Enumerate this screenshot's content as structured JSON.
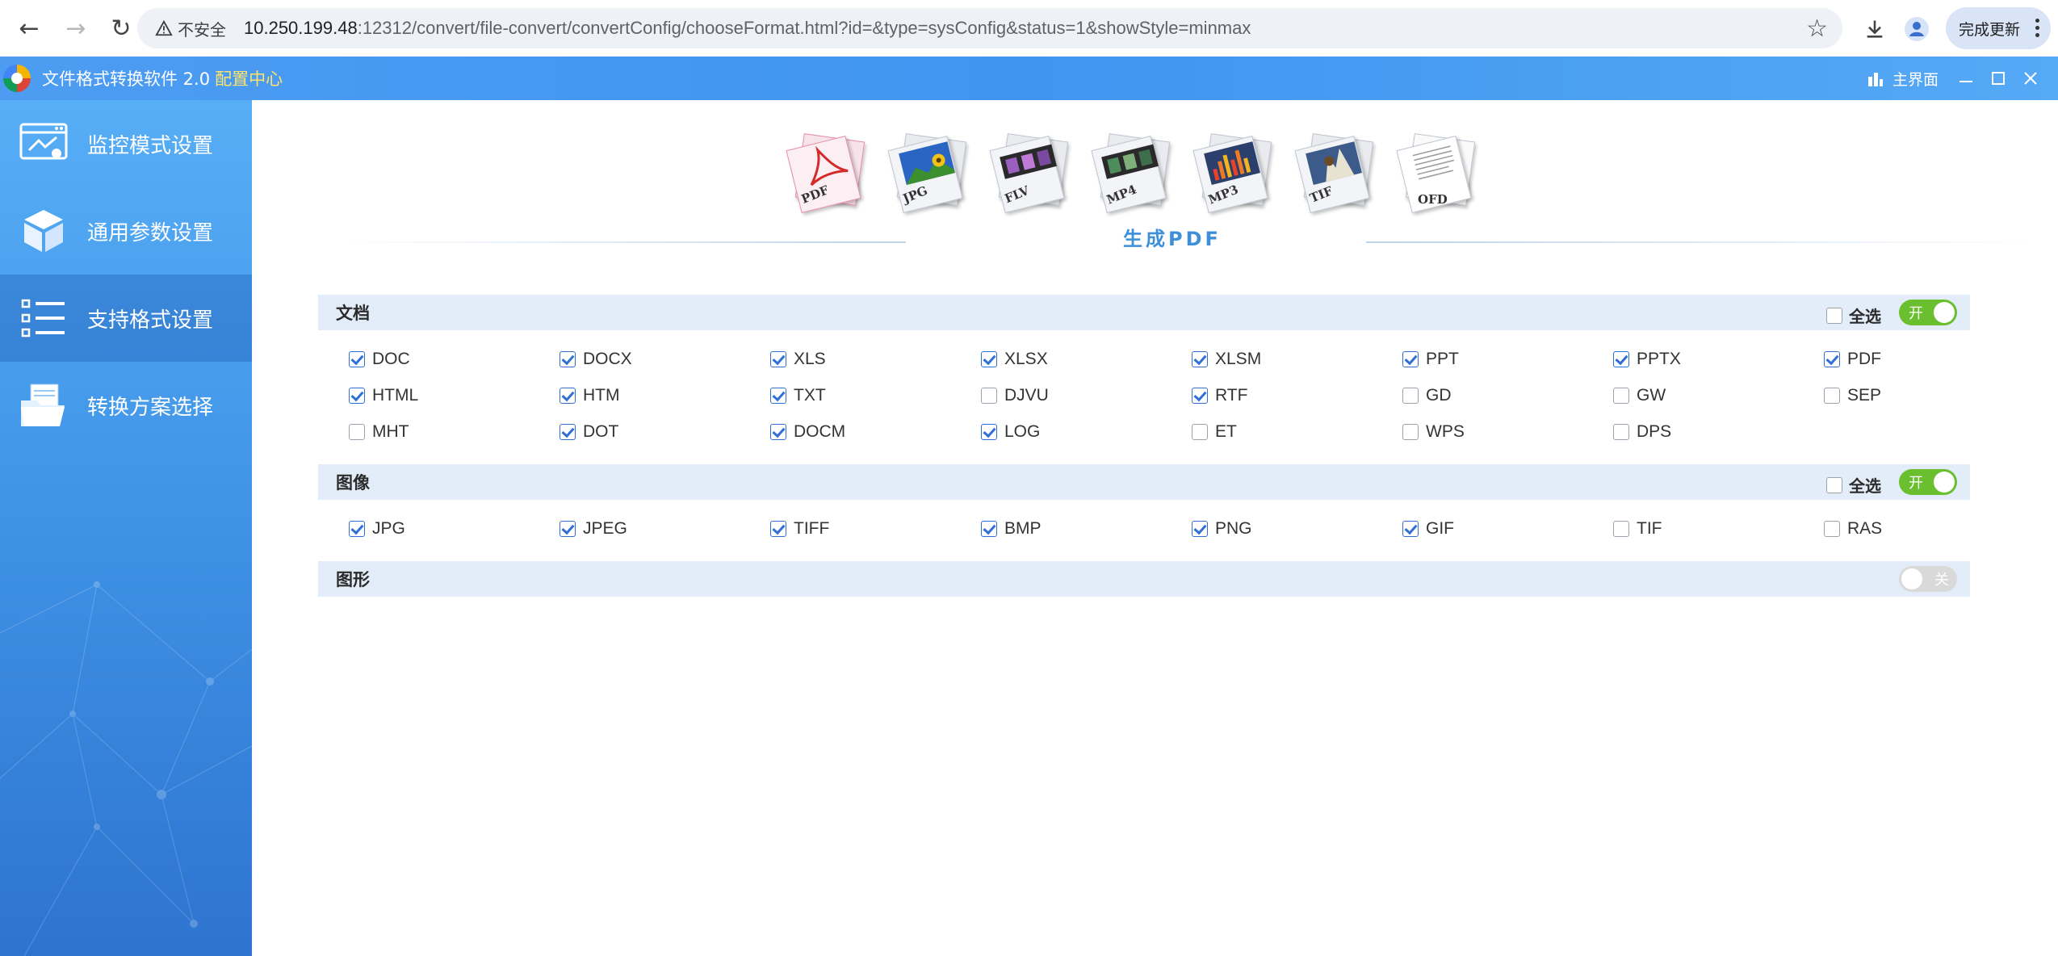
{
  "browser": {
    "security_label": "不安全",
    "url_host": "10.250.199.48",
    "url_path": ":12312/convert/file-convert/convertConfig/chooseFormat.html?id=&type=sysConfig&status=1&showStyle=minmax",
    "update_label": "完成更新"
  },
  "app": {
    "title": "文件格式转换软件 2.0",
    "subtitle": "配置中心",
    "main_label": "主界面"
  },
  "sidebar": {
    "items": [
      {
        "label": "监控模式设置",
        "active": false
      },
      {
        "label": "通用参数设置",
        "active": false
      },
      {
        "label": "支持格式设置",
        "active": true
      },
      {
        "label": "转换方案选择",
        "active": false
      }
    ]
  },
  "format_icons": [
    {
      "label": "PDF",
      "icon": "pdf-icon",
      "selected": true
    },
    {
      "label": "JPG",
      "icon": "jpg-icon",
      "selected": false
    },
    {
      "label": "FLV",
      "icon": "flv-icon",
      "selected": false
    },
    {
      "label": "MP4",
      "icon": "mp4-icon",
      "selected": false
    },
    {
      "label": "MP3",
      "icon": "mp3-icon",
      "selected": false
    },
    {
      "label": "TIF",
      "icon": "tif-icon",
      "selected": false
    },
    {
      "label": "OFD",
      "icon": "ofd-icon",
      "selected": false
    }
  ],
  "generate_title": "生成PDF",
  "sections": [
    {
      "title": "文档",
      "select_all_label": "全选",
      "select_all_checked": false,
      "toggle_label": "开",
      "toggle_on": true,
      "formats": [
        {
          "label": "DOC",
          "checked": true
        },
        {
          "label": "DOCX",
          "checked": true
        },
        {
          "label": "XLS",
          "checked": true
        },
        {
          "label": "XLSX",
          "checked": true
        },
        {
          "label": "XLSM",
          "checked": true
        },
        {
          "label": "PPT",
          "checked": true
        },
        {
          "label": "PPTX",
          "checked": true
        },
        {
          "label": "PDF",
          "checked": true
        },
        {
          "label": "HTML",
          "checked": true
        },
        {
          "label": "HTM",
          "checked": true
        },
        {
          "label": "TXT",
          "checked": true
        },
        {
          "label": "DJVU",
          "checked": false
        },
        {
          "label": "RTF",
          "checked": true
        },
        {
          "label": "GD",
          "checked": false
        },
        {
          "label": "GW",
          "checked": false
        },
        {
          "label": "SEP",
          "checked": false
        },
        {
          "label": "MHT",
          "checked": false
        },
        {
          "label": "DOT",
          "checked": true
        },
        {
          "label": "DOCM",
          "checked": true
        },
        {
          "label": "LOG",
          "checked": true
        },
        {
          "label": "ET",
          "checked": false
        },
        {
          "label": "WPS",
          "checked": false
        },
        {
          "label": "DPS",
          "checked": false
        }
      ]
    },
    {
      "title": "图像",
      "select_all_label": "全选",
      "select_all_checked": false,
      "toggle_label": "开",
      "toggle_on": true,
      "formats": [
        {
          "label": "JPG",
          "checked": true
        },
        {
          "label": "JPEG",
          "checked": true
        },
        {
          "label": "TIFF",
          "checked": true
        },
        {
          "label": "BMP",
          "checked": true
        },
        {
          "label": "PNG",
          "checked": true
        },
        {
          "label": "GIF",
          "checked": true
        },
        {
          "label": "TIF",
          "checked": false
        },
        {
          "label": "RAS",
          "checked": false
        }
      ]
    },
    {
      "title": "图形",
      "toggle_label": "关",
      "toggle_on": false,
      "formats": []
    }
  ],
  "colors": {
    "accent_blue": "#3d8fd9",
    "toggle_on": "#6abf2e",
    "toggle_off": "#d9d9d9",
    "section_bg": "#e3edf9",
    "check_blue": "#2f6fd6"
  }
}
